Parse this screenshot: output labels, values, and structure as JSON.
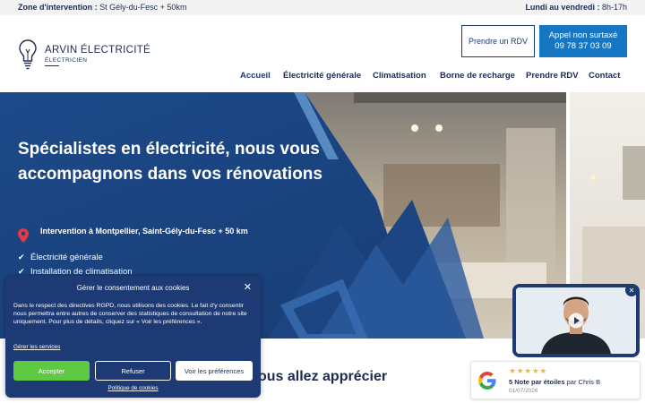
{
  "topbar": {
    "zone_label": "Zone d'intervention :",
    "zone_value": "St Gély-du-Fesc + 50km",
    "hours_label": "Lundi au vendredi :",
    "hours_value": "8h-17h"
  },
  "brand": {
    "name": "ARVIN ÉLECTRICITÉ",
    "subtitle": "ÉLECTRICIEN"
  },
  "header_buttons": {
    "rdv": "Prendre un RDV",
    "call_line1": "Appel non surtaxé",
    "call_line2": "09 78 37 03 09"
  },
  "nav": {
    "items": [
      "Accueil",
      "Électricité générale",
      "Climatisation",
      "Borne de recharge",
      "Prendre RDV",
      "Contact"
    ],
    "active": "Accueil"
  },
  "hero": {
    "title": "Spécialistes en électricité, nous vous accompagnons dans vos rénovations",
    "location": "Intervention à Montpellier, Saint-Gély-du-Fesc + 50 km",
    "checklist": [
      "Électricité générale",
      "Installation de climatisation"
    ]
  },
  "below": {
    "heading_partial": "ous allez apprécier"
  },
  "cookie": {
    "title": "Gérer le consentement aux cookies",
    "body": "Dans le respect des directives RGPD, nous utilisons des cookies. Le fait d'y consentir nous permettra entre autres de conserver des statistiques de consultation de notre site uniquement. Pour plus de détails, cliquez sur « Voir les préférences ».",
    "manage_link": "Gérer les services",
    "accept": "Accepter",
    "refuse": "Refuser",
    "prefs": "Voir les préférences",
    "policy": "Politique de cookies"
  },
  "review": {
    "stars": "★★★★★",
    "rating_text": "5 Note par étoiles",
    "by": "par Chris B",
    "date": "01/07/2026"
  },
  "colors": {
    "primary_blue": "#1d3a72",
    "call_blue": "#1577c4",
    "accept_green": "#5fc944",
    "star_gold": "#f3b83a"
  },
  "icons": {
    "logo": "lightbulb-icon",
    "pin": "map-pin-icon",
    "check": "check-icon",
    "close": "close-icon",
    "play": "play-icon",
    "google": "google-icon"
  }
}
